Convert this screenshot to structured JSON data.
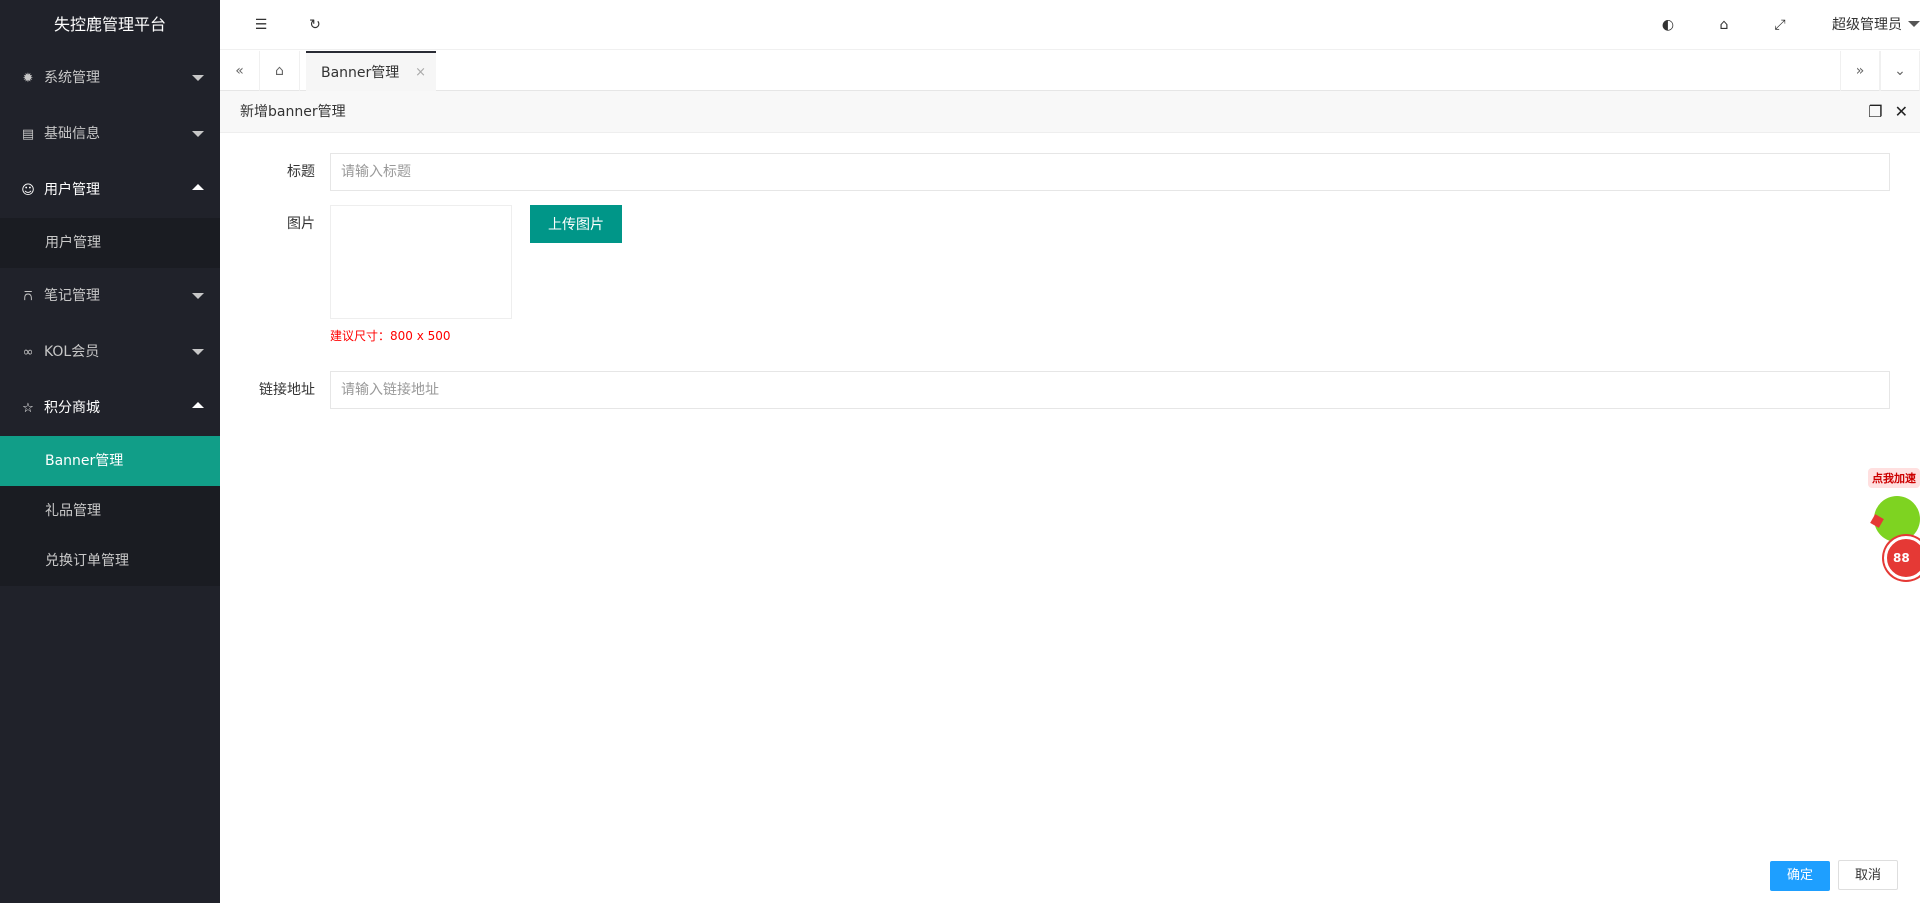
{
  "app": {
    "title": "失控鹿管理平台"
  },
  "sidebar": {
    "groups": [
      {
        "label": "系统管理",
        "icon": "gear-icon"
      },
      {
        "label": "基础信息",
        "icon": "document-icon"
      },
      {
        "label": "用户管理",
        "icon": "user-icon",
        "items": [
          {
            "label": "用户管理"
          }
        ]
      },
      {
        "label": "笔记管理",
        "icon": "book-icon"
      },
      {
        "label": "KOL会员",
        "icon": "link-icon"
      },
      {
        "label": "积分商城",
        "icon": "star-icon",
        "items": [
          {
            "label": "Banner管理"
          },
          {
            "label": "礼品管理"
          },
          {
            "label": "兑换订单管理"
          }
        ]
      }
    ]
  },
  "header": {
    "user": "超级管理员"
  },
  "tabs": {
    "active": "Banner管理",
    "close": "×"
  },
  "dialog": {
    "title": "新增banner管理",
    "fields": {
      "title_label": "标题",
      "title_placeholder": "请输入标题",
      "image_label": "图片",
      "upload_label": "上传图片",
      "hint": "建议尺寸：800 x 500",
      "link_label": "链接地址",
      "link_placeholder": "请输入链接地址"
    },
    "ok": "确定",
    "cancel": "取消"
  },
  "widget": {
    "label": "点我加速",
    "badge": "88"
  },
  "colors": {
    "sidebar": "#20222a",
    "active": "#119e88",
    "primary": "#1E9FFF",
    "upload": "#009688",
    "hint": "#ff0000"
  }
}
